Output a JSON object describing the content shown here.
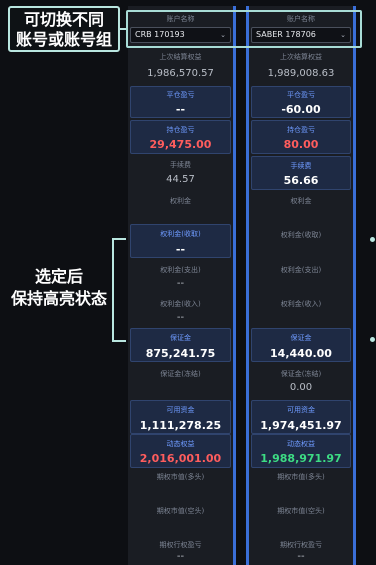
{
  "annotations": {
    "switch_line1": "可切换不同",
    "switch_line2": "账号或账号组",
    "keep_line1": "选定后",
    "keep_line2": "保持高亮状态"
  },
  "columns": [
    {
      "account_header": "账户名称",
      "account_value": "CRB  170193",
      "rows": [
        {
          "label": "上次结算权益",
          "value": "1,986,570.57"
        },
        {
          "label": "平仓盈亏",
          "value": "--"
        },
        {
          "label": "持仓盈亏",
          "value": "29,475.00"
        },
        {
          "label": "手续费",
          "value": "44.57"
        },
        {
          "label": "权利金",
          "value": ""
        },
        {
          "label": "权利金(收取)",
          "value": "--"
        },
        {
          "label": "权利金(支出)",
          "value": "--"
        },
        {
          "label": "权利金(收入)",
          "value": "--"
        },
        {
          "label": "保证金",
          "value": "875,241.75"
        },
        {
          "label": "保证金(冻结)",
          "value": ""
        },
        {
          "label": "可用资金",
          "value": "1,111,278.25"
        },
        {
          "label": "动态权益",
          "value": "2,016,001.00"
        },
        {
          "label": "期权市值(多头)",
          "value": ""
        },
        {
          "label": "期权市值(空头)",
          "value": ""
        },
        {
          "label": "期权行权盈亏",
          "value": "--"
        }
      ]
    },
    {
      "account_header": "账户名称",
      "account_value": "SABER  178706",
      "rows": [
        {
          "label": "上次结算权益",
          "value": "1,989,008.63"
        },
        {
          "label": "平仓盈亏",
          "value": "-60.00"
        },
        {
          "label": "持仓盈亏",
          "value": "80.00"
        },
        {
          "label": "手续费",
          "value": "56.66"
        },
        {
          "label": "权利金",
          "value": ""
        },
        {
          "label": "权利金(收取)",
          "value": ""
        },
        {
          "label": "权利金(支出)",
          "value": ""
        },
        {
          "label": "权利金(收入)",
          "value": ""
        },
        {
          "label": "保证金",
          "value": "14,440.00"
        },
        {
          "label": "保证金(冻结)",
          "value": "0.00"
        },
        {
          "label": "可用资金",
          "value": "1,974,451.97"
        },
        {
          "label": "动态权益",
          "value": "1,988,971.97"
        },
        {
          "label": "期权市值(多头)",
          "value": ""
        },
        {
          "label": "期权市值(空头)",
          "value": ""
        },
        {
          "label": "期权行权盈亏",
          "value": "--"
        }
      ]
    }
  ],
  "colors": {
    "accent": "#3a6fd8",
    "profit": "#ff5d5d",
    "loss": "#3ddc84",
    "annotation": "#b9e6e0"
  }
}
